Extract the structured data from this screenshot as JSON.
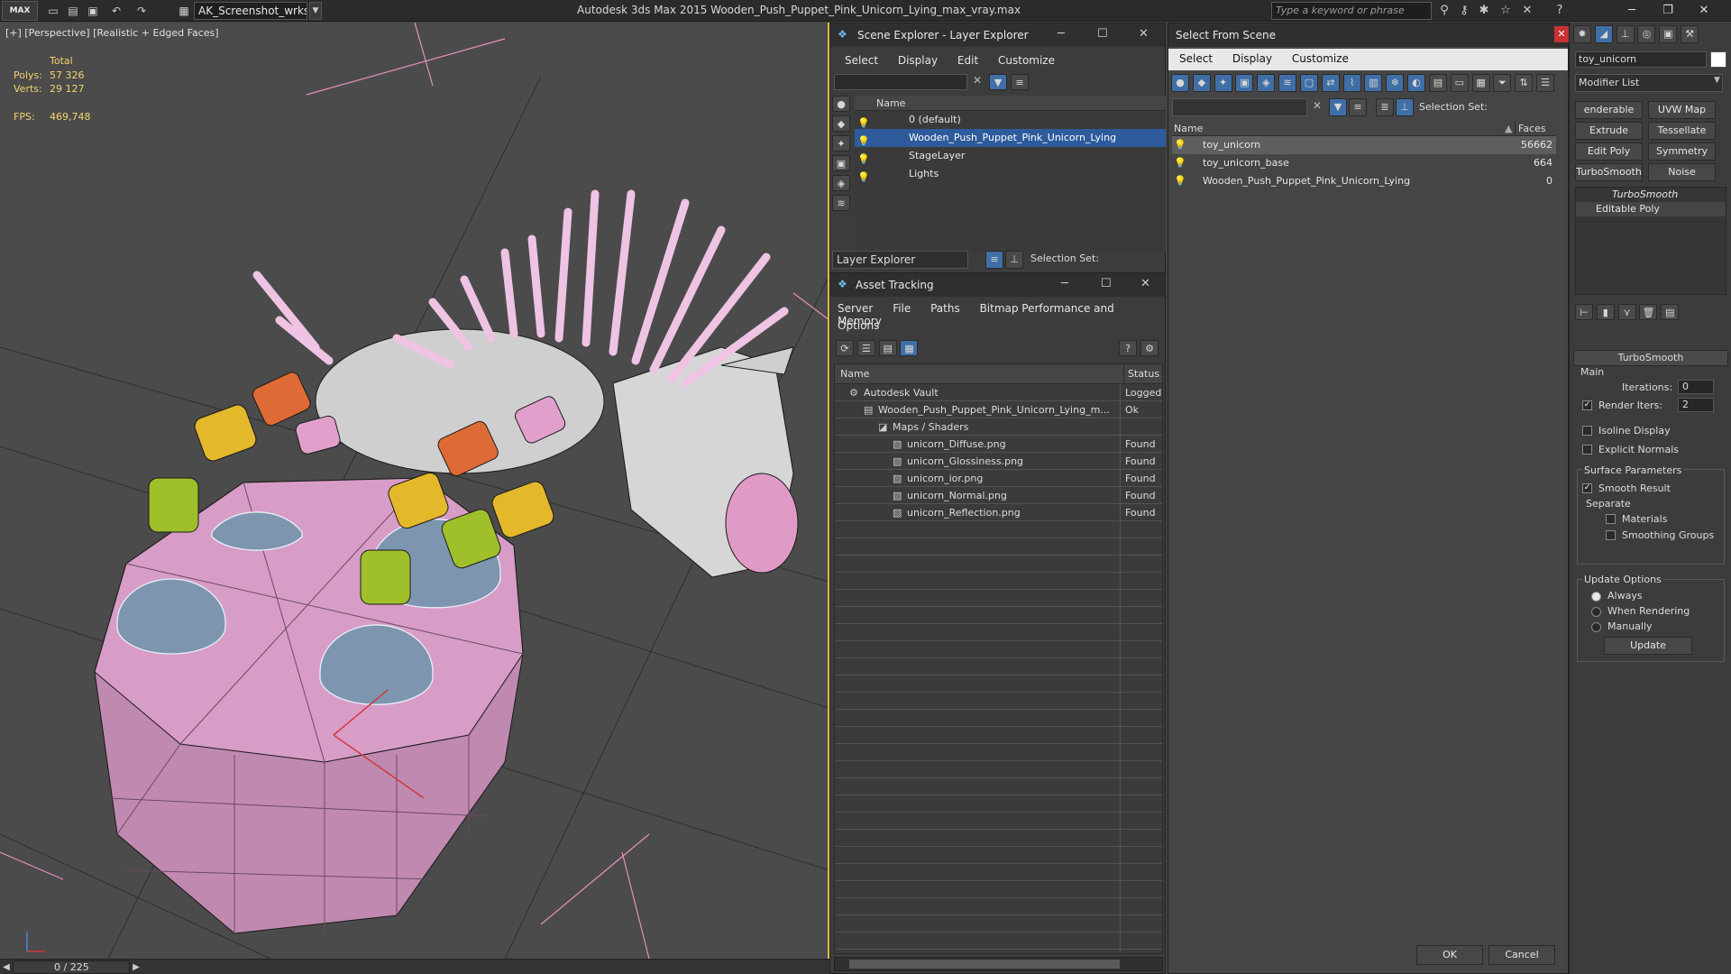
{
  "app": {
    "logo": "MAX",
    "workspace": "AK_Screenshot_wrksp",
    "title": "Autodesk 3ds Max  2015    Wooden_Push_Puppet_Pink_Unicorn_Lying_max_vray.max",
    "search_placeholder": "Type a keyword or phrase"
  },
  "viewport": {
    "label": "[+] [Perspective] [Realistic + Edged Faces]",
    "stats_total": "Total",
    "polys_label": "Polys:",
    "polys": "57 326",
    "verts_label": "Verts:",
    "verts": "29 127",
    "fps_label": "FPS:",
    "fps": "469,748",
    "frame": "0 / 225"
  },
  "scene_explorer": {
    "title": "Scene Explorer - Layer Explorer",
    "menu": [
      "Select",
      "Display",
      "Edit",
      "Customize"
    ],
    "col_name": "Name",
    "layers": [
      "0 (default)",
      "Wooden_Push_Puppet_Pink_Unicorn_Lying",
      "StageLayer",
      "Lights"
    ],
    "selected_layer": 1,
    "footer_dropdown": "Layer Explorer",
    "selection_set": "Selection Set:"
  },
  "asset_tracking": {
    "title": "Asset Tracking",
    "menu": [
      "Server",
      "File",
      "Paths",
      "Bitmap Performance and Memory"
    ],
    "menu2": "Options",
    "col_name": "Name",
    "col_status": "Status",
    "rows": [
      {
        "name": "Autodesk Vault",
        "status": "Logged",
        "indent": 1
      },
      {
        "name": "Wooden_Push_Puppet_Pink_Unicorn_Lying_m...",
        "status": "Ok",
        "indent": 2
      },
      {
        "name": "Maps / Shaders",
        "status": "",
        "indent": 3
      },
      {
        "name": "unicorn_Diffuse.png",
        "status": "Found",
        "indent": 4
      },
      {
        "name": "unicorn_Glossiness.png",
        "status": "Found",
        "indent": 4
      },
      {
        "name": "unicorn_ior.png",
        "status": "Found",
        "indent": 4
      },
      {
        "name": "unicorn_Normal.png",
        "status": "Found",
        "indent": 4
      },
      {
        "name": "unicorn_Reflection.png",
        "status": "Found",
        "indent": 4
      }
    ]
  },
  "select_from_scene": {
    "title": "Select From Scene",
    "menu": [
      "Select",
      "Display",
      "Customize"
    ],
    "selection_set": "Selection Set:",
    "col_name": "Name",
    "col_faces": "Faces",
    "rows": [
      {
        "name": "toy_unicorn",
        "faces": "56662"
      },
      {
        "name": "toy_unicorn_base",
        "faces": "664"
      },
      {
        "name": "Wooden_Push_Puppet_Pink_Unicorn_Lying",
        "faces": "0"
      }
    ],
    "ok": "OK",
    "cancel": "Cancel"
  },
  "command_panel": {
    "object_name": "toy_unicorn",
    "modifier_list": "Modifier List",
    "buttons": [
      "enderable Spli",
      "UVW Map",
      "Extrude",
      "Tessellate",
      "Edit Poly",
      "Symmetry",
      "TurboSmooth",
      "Noise"
    ],
    "stack": [
      "TurboSmooth",
      "Editable Poly"
    ],
    "rollout_title": "TurboSmooth",
    "main_label": "Main",
    "iterations_label": "Iterations:",
    "iterations": "0",
    "render_iters_label": "Render Iters:",
    "render_iters": "2",
    "isoline": "Isoline Display",
    "explicit_normals": "Explicit Normals",
    "surface_params": "Surface Parameters",
    "smooth_result": "Smooth Result",
    "separate": "Separate",
    "materials": "Materials",
    "smoothing_groups": "Smoothing Groups",
    "update_options": "Update Options",
    "always": "Always",
    "when_rendering": "When Rendering",
    "manually": "Manually",
    "update": "Update"
  }
}
